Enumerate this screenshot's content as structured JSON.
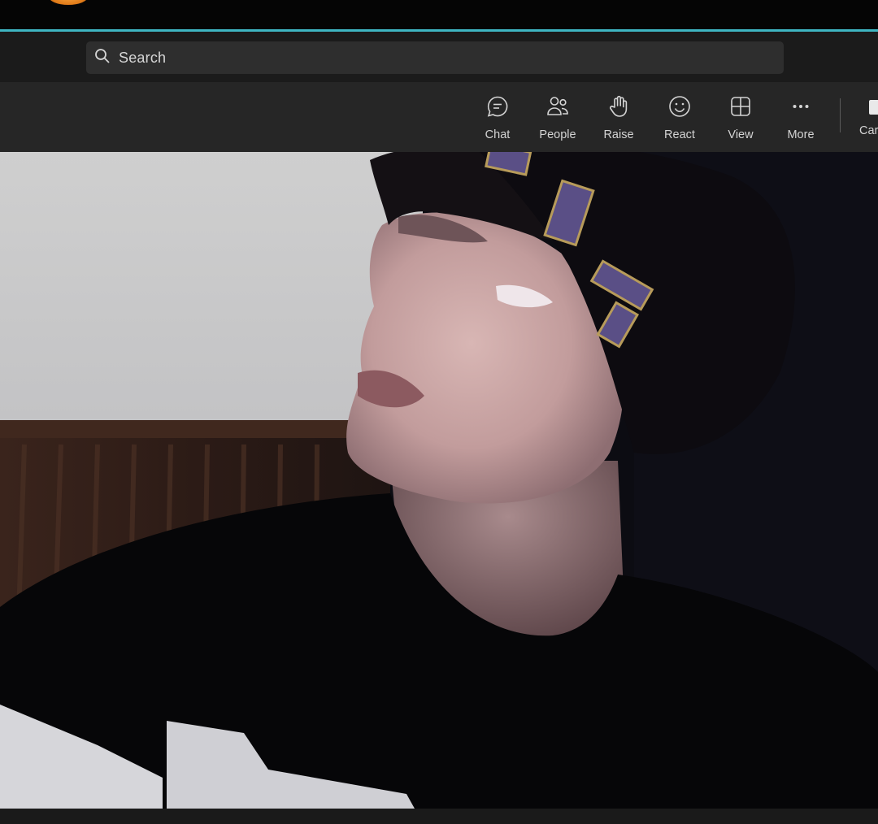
{
  "search": {
    "placeholder": "Search"
  },
  "toolbar": {
    "items": [
      {
        "label": "Chat",
        "icon": "chat-icon"
      },
      {
        "label": "People",
        "icon": "people-icon"
      },
      {
        "label": "Raise",
        "icon": "hand-icon"
      },
      {
        "label": "React",
        "icon": "smiley-icon"
      },
      {
        "label": "View",
        "icon": "grid-icon"
      },
      {
        "label": "More",
        "icon": "more-icon"
      }
    ],
    "camera_label": "Car"
  },
  "colors": {
    "accent": "#3fb6c2",
    "toolbar_bg": "#262626",
    "search_bg": "#2e2e2e",
    "text": "#d4d4d4"
  }
}
